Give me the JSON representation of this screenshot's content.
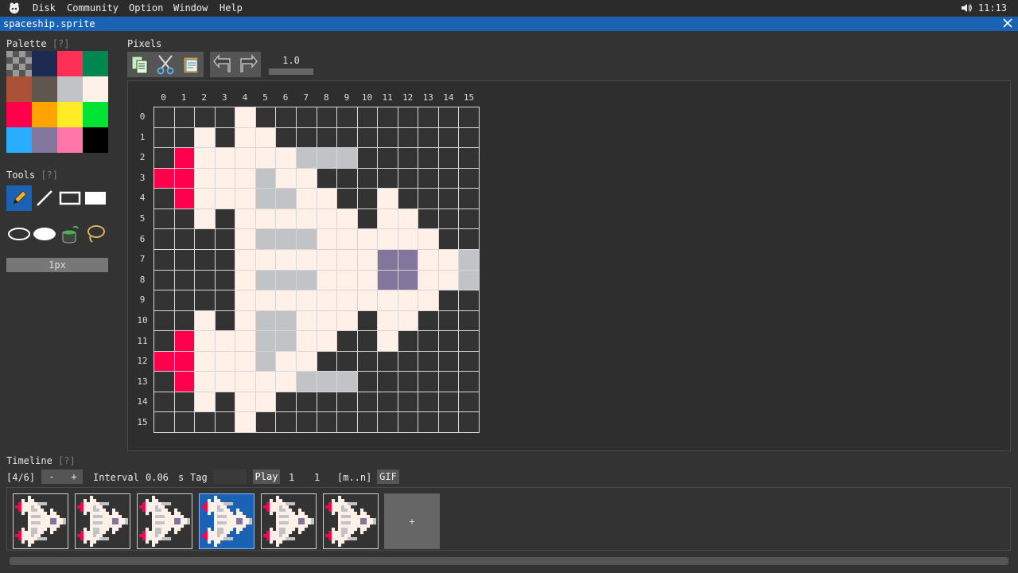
{
  "menubar": {
    "items": [
      "Disk",
      "Community",
      "Option",
      "Window",
      "Help"
    ],
    "clock": "11:13"
  },
  "window": {
    "title": "spaceship.sprite"
  },
  "palette": {
    "title": "Palette",
    "help": "[?]",
    "colors": [
      "transparent",
      "#1d2b53",
      "#ff2f55",
      "#008751",
      "#ab5236",
      "#5f574f",
      "#c2c3c7",
      "#fff1e8",
      "#ff004d",
      "#ffa300",
      "#ffec27",
      "#00e436",
      "#29adff",
      "#83769c",
      "#ff77a8",
      "#000000"
    ]
  },
  "tools": {
    "title": "Tools",
    "help": "[?]",
    "items": [
      "pencil",
      "line",
      "rectangle",
      "filled-rectangle",
      "ellipse",
      "filled-ellipse",
      "bucket-fill",
      "lasso"
    ],
    "selected": "pencil",
    "brush_size": "1px"
  },
  "pixels": {
    "title": "Pixels",
    "zoom": "1.0",
    "columns": [
      "0",
      "1",
      "2",
      "3",
      "4",
      "5",
      "6",
      "7",
      "8",
      "9",
      "10",
      "11",
      "12",
      "13",
      "14",
      "15"
    ],
    "rows": [
      "0",
      "1",
      "2",
      "3",
      "4",
      "5",
      "6",
      "7",
      "8",
      "9",
      "10",
      "11",
      "12",
      "13",
      "14",
      "15"
    ],
    "image": [
      "....W...........",
      "..W.WW..........",
      ".RWWWWWGGG......",
      "RRWWWGWW........",
      ".RWWWGGWW..W....",
      "..W.WWWWWW.WW...",
      "....WGGGWWWWWW..",
      "....WWWWWWWPPWWG",
      "....WGGGWWWPPWWG",
      "....WWWWWWWWWW..",
      "..W.WGGWWW.WW...",
      ".RWWWGGWW..W....",
      "RRWWWGWW........",
      ".RWWWWWGGG......",
      "..W.WW..........",
      "....W..........."
    ],
    "legend": {
      "R": "#ff004d",
      "W": "#fff1e8",
      "G": "#c2c3c7",
      "P": "#83769c"
    }
  },
  "timeline": {
    "title": "Timeline",
    "help": "[?]",
    "frame_counter": "[4/6]",
    "minus": "-",
    "plus": "+",
    "interval_label": "Interval",
    "interval_value": "0.06",
    "interval_unit": "s",
    "tag_label": "Tag",
    "tag_value": "",
    "play": "Play",
    "range_start": "1",
    "range_end": "1",
    "range_format": "[m..n]",
    "gif": "GIF",
    "frame_count": 6,
    "selected_frame": 4,
    "add_frame": "+"
  }
}
